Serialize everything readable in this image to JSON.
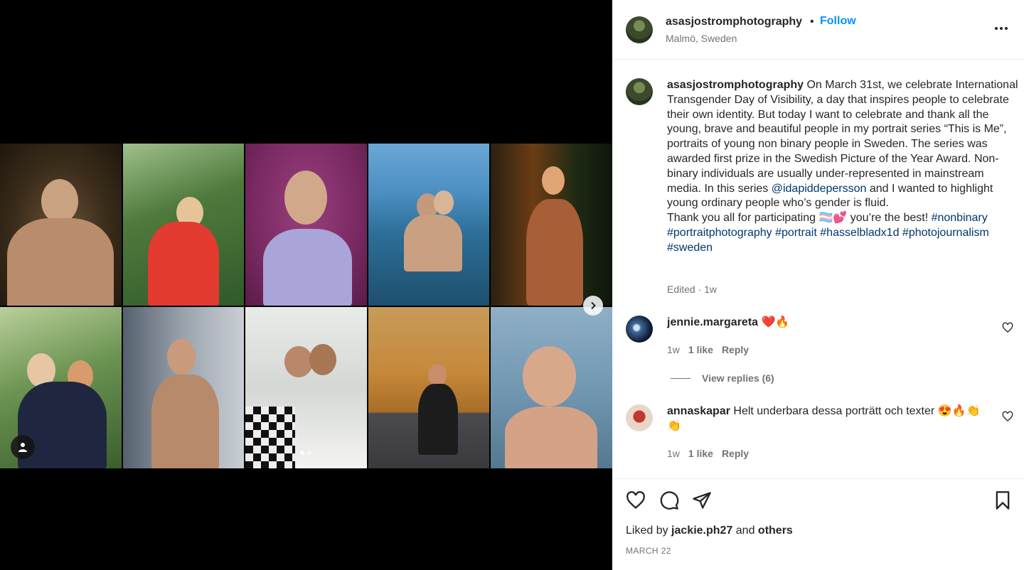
{
  "post": {
    "username": "asasjostromphotography",
    "separator": "•",
    "follow_label": "Follow",
    "location": "Malmö, Sweden",
    "more_icon": "more-horizontal-icon"
  },
  "caption": {
    "username": "asasjostromphotography",
    "text_1": " On March 31st, we celebrate International Transgender Day of Visibility, a day that inspires people to celebrate their own identity. But today I want to celebrate and thank all the young, brave and beautiful people in my portrait series “This is Me”, portraits of young non binary people in Sweden. The series was awarded first prize in the Swedish Picture of the Year Award. Non-binary individuals are usually under-represented in mainstream media. In this series ",
    "mention": "@idapiddepersson",
    "text_2": " and I wanted to highlight young ordinary people who’s gender is fluid.",
    "text_3": "Thank you all for participating 🏳️‍⚧️💕 you’re the best! ",
    "hashtags": [
      "#nonbinary",
      "#portraitphotography",
      "#portrait",
      "#hasselbladx1d",
      "#photojournalism",
      "#sweden"
    ],
    "edited": "Edited · 1w"
  },
  "comments": [
    {
      "username": "jennie.margareta",
      "text": " ❤️🔥",
      "age": "1w",
      "likes": "1 like",
      "reply": "Reply",
      "view_replies": "View replies (6)"
    },
    {
      "username": "annaskapar",
      "text": " Helt underbara dessa porträtt och texter 😍🔥👏👏",
      "age": "1w",
      "likes": "1 like",
      "reply": "Reply"
    }
  ],
  "footer": {
    "liked_prefix": "Liked by ",
    "liked_user": "jackie.ph27",
    "liked_and": " and ",
    "liked_others": "others",
    "date": "MARCH 22"
  },
  "carousel": {
    "slide_count": 2,
    "active_slide": 1
  },
  "colors": {
    "follow": "#0095f6",
    "link": "#00376b",
    "muted": "#737373"
  }
}
